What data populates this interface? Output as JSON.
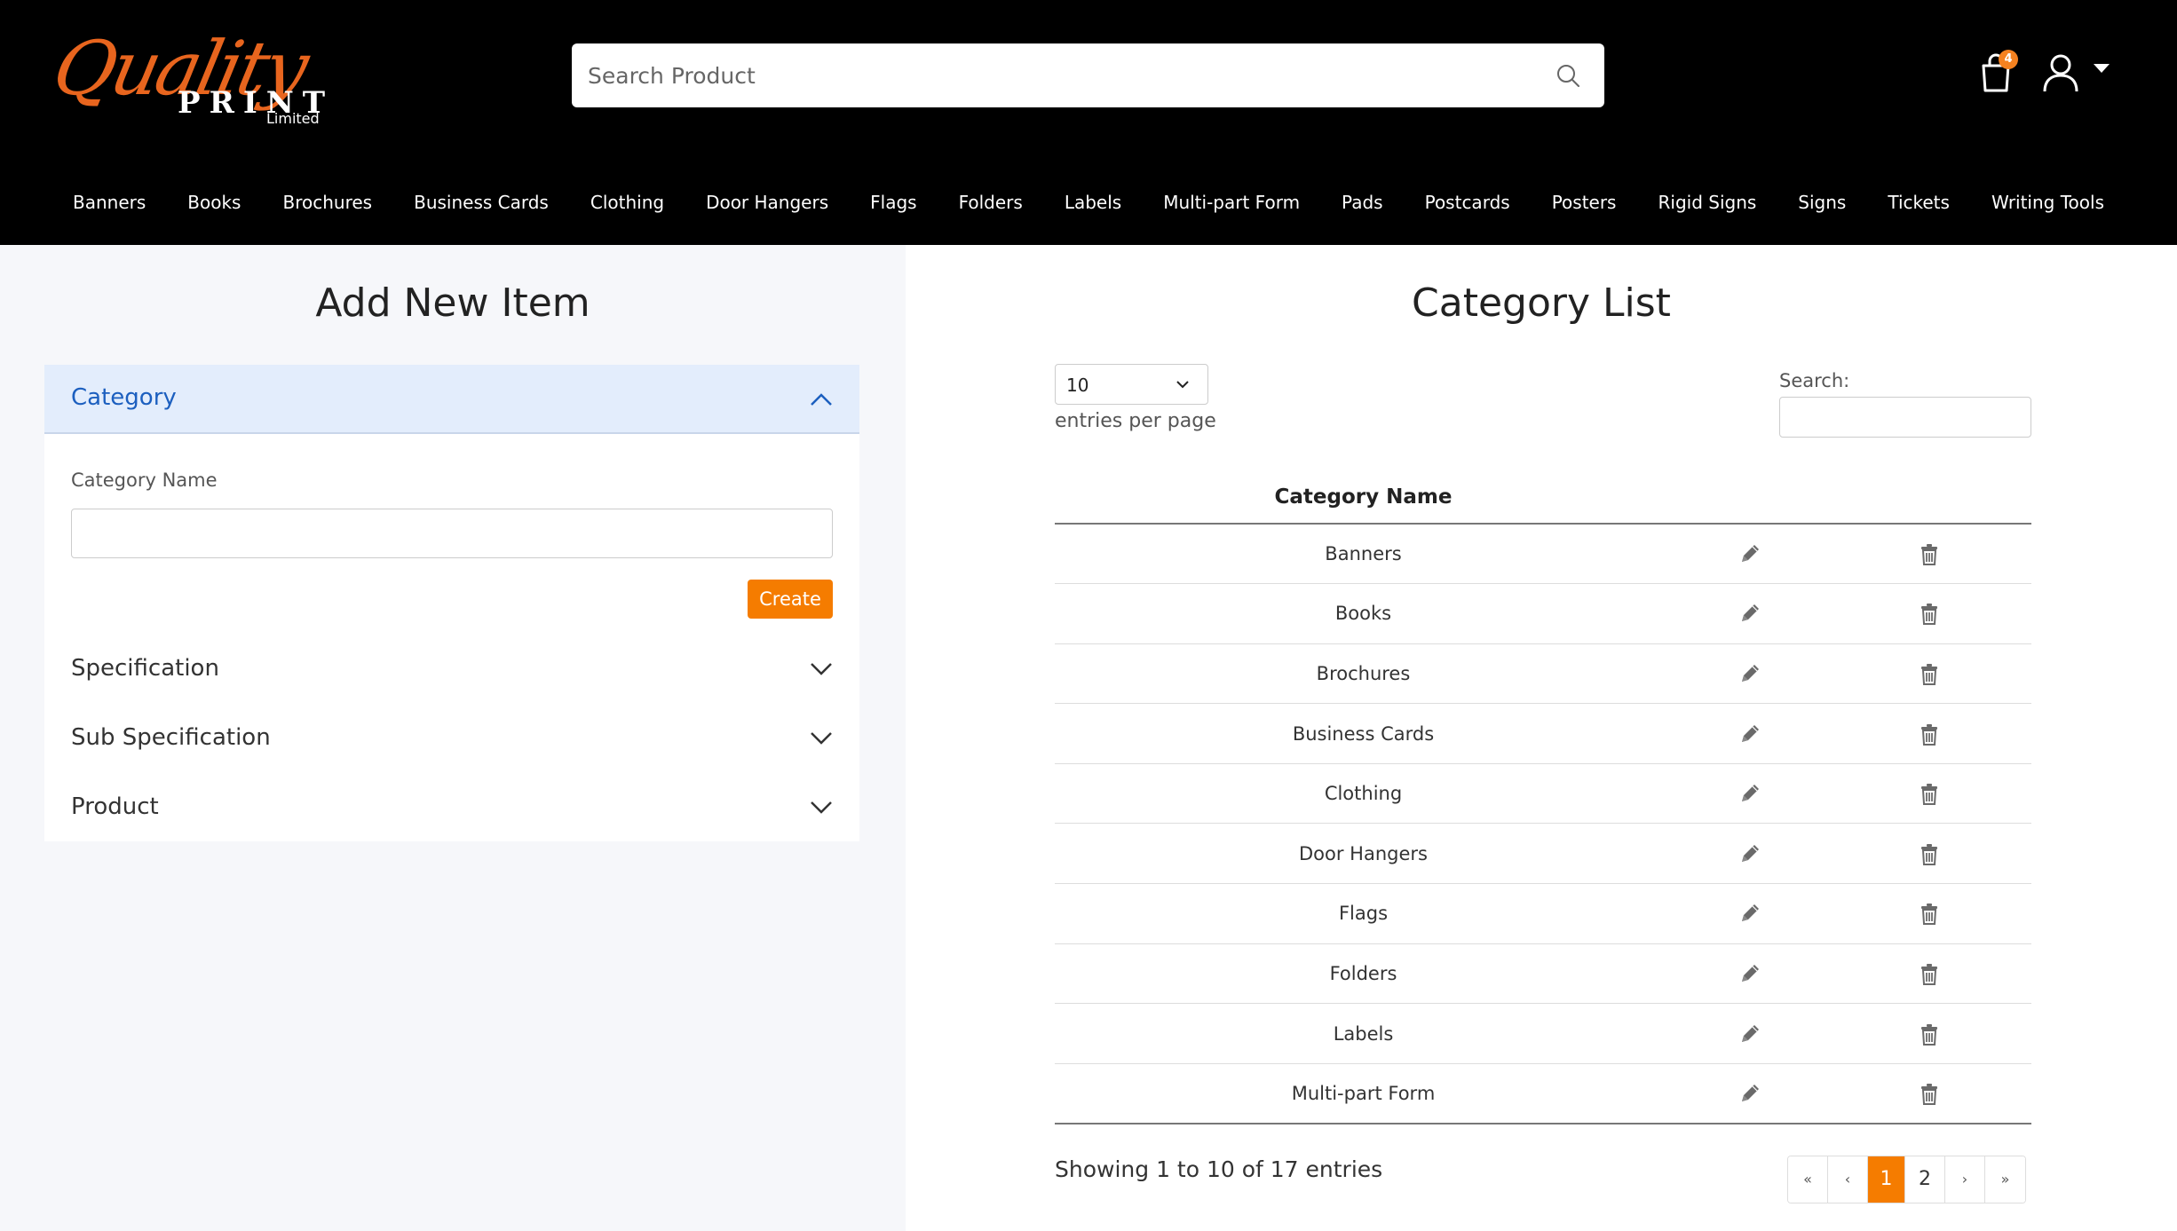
{
  "brand": {
    "script": "Quality",
    "print": "PRINT",
    "limited": "Limited",
    "accent_color": "#e8651e"
  },
  "header": {
    "search_placeholder": "Search Product",
    "cart_count": "4",
    "nav": [
      "Banners",
      "Books",
      "Brochures",
      "Business Cards",
      "Clothing",
      "Door Hangers",
      "Flags",
      "Folders",
      "Labels",
      "Multi-part Form",
      "Pads",
      "Postcards",
      "Posters",
      "Rigid Signs",
      "Signs",
      "Tickets",
      "Writing Tools"
    ]
  },
  "left": {
    "title": "Add New Item",
    "category": {
      "header": "Category",
      "field_label": "Category Name",
      "create_label": "Create"
    },
    "sections": [
      "Specification",
      "Sub Specification",
      "Product"
    ]
  },
  "right": {
    "title": "Category List",
    "per_page_value": "10",
    "per_page_label": "entries per page",
    "search_label": "Search:",
    "column_header": "Category Name",
    "rows": [
      "Banners",
      "Books",
      "Brochures",
      "Business Cards",
      "Clothing",
      "Door Hangers",
      "Flags",
      "Folders",
      "Labels",
      "Multi-part Form"
    ],
    "info": "Showing 1 to 10 of 17 entries",
    "pager": {
      "first": "«",
      "prev": "‹",
      "pages": [
        "1",
        "2"
      ],
      "active_page": "1",
      "next": "›",
      "last": "»"
    }
  },
  "colors": {
    "primary_orange": "#f57c00",
    "active_blue": "#1c5fbf"
  }
}
